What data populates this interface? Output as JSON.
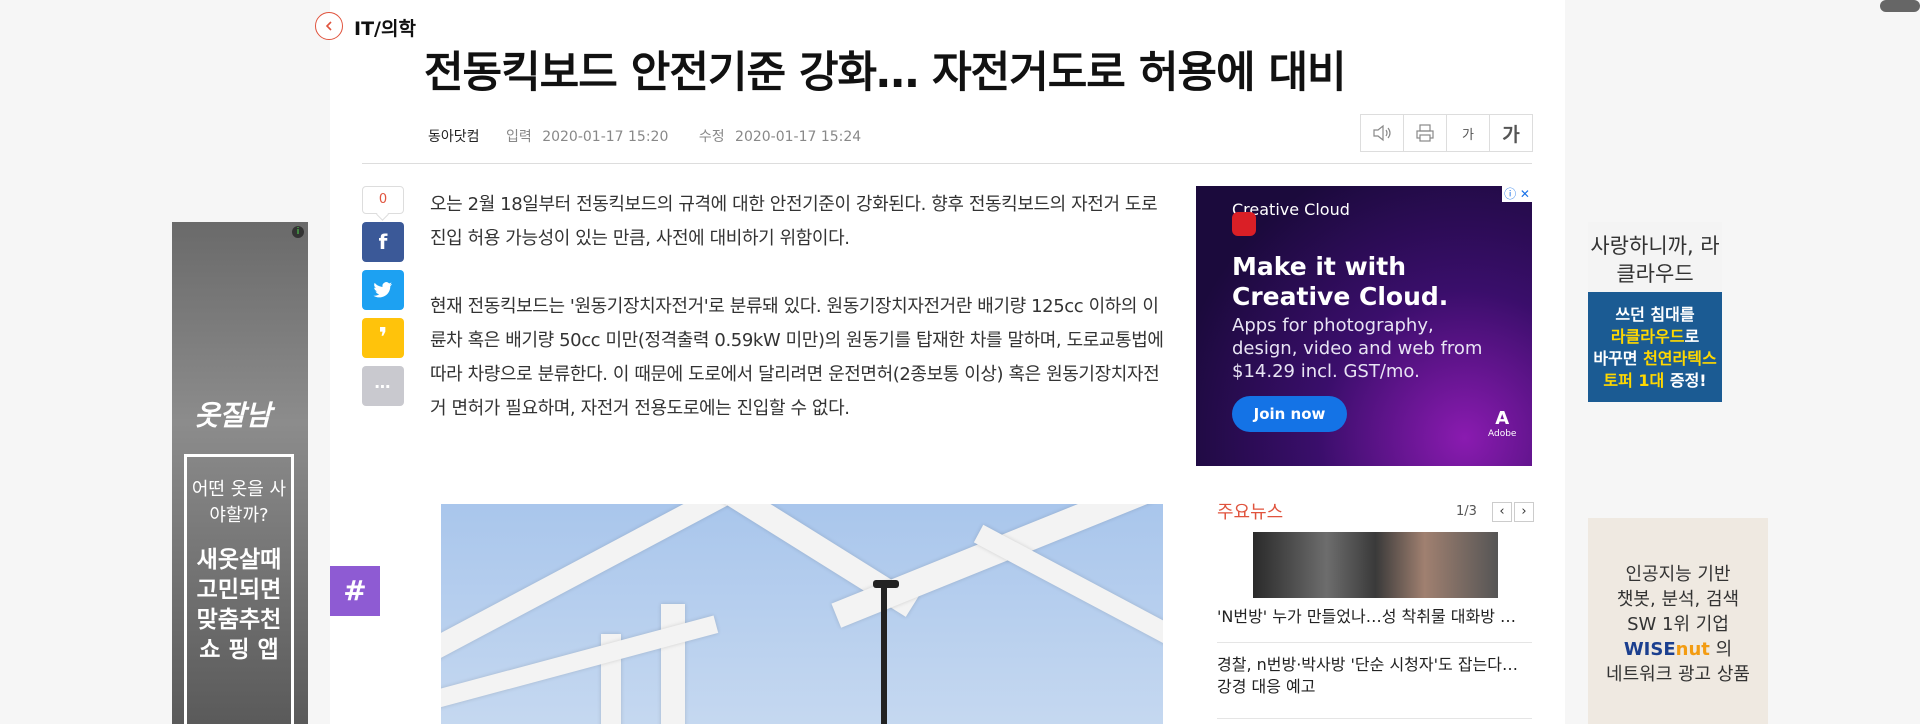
{
  "section": {
    "name": "IT/의학"
  },
  "article": {
    "headline": "전동킥보드 안전기준 강화… 자전거도로 허용에 대비",
    "source": "동아닷컴",
    "input_label": "입력",
    "input_time": "2020-01-17 15:20",
    "modified_label": "수정",
    "modified_time": "2020-01-17 15:24",
    "paragraphs": [
      "오는 2월 18일부터 전동킥보드의 규격에 대한 안전기준이 강화된다. 향후 전동킥보드의 자전거 도로 진입 허용 가능성이 있는 만큼, 사전에 대비하기 위함이다.",
      "현재 전동킥보드는 '원동기장치자전거'로 분류돼 있다. 원동기장치자전거란 배기량 125cc 이하의 이륜차 혹은 배기량 50cc 미만(정격출력 0.59kW 미만)의 원동기를 탑재한 차를 말하며, 도로교통법에 따라 차량으로 분류한다. 이 때문에 도로에서 달리려면 운전면허(2종보통 이상) 혹은 원동기장치자전거 면허가 필요하며, 자전거 전용도로에는 진입할 수 없다."
    ]
  },
  "tools": {
    "font_small": "가",
    "font_large": "가"
  },
  "share": {
    "like_count": "0",
    "facebook": "f",
    "kakaostory": "❜",
    "more": "⋯"
  },
  "hashtag": {
    "label": "#"
  },
  "ad_cc": {
    "brand": "Creative Cloud",
    "headline": "Make it with Creative Cloud.",
    "sub": "Apps for photography, design, video and web from $14.29 incl. GST/mo.",
    "button": "Join now",
    "maker": "Adobe",
    "close": "ⓘ ✕"
  },
  "main_news": {
    "title": "주요뉴스",
    "page": "1/3",
    "prev": "‹",
    "next": "›",
    "items": [
      "'N번방' 누가 만들었나…성 착취물 대화방 …",
      "경찰, n번방·박사방 '단순 시청자'도 잡는다… 강경 대응 예고"
    ]
  },
  "left_ad": {
    "brand": "옷잘남",
    "question": "어떤 옷을 사야할까?",
    "tagline": "새옷살때 고민되면 맞춤추천 쇼 핑 앱",
    "info": "i"
  },
  "right_ad1": {
    "top": "사랑하니까, 라클라우드",
    "line1": "쓰던 침대를",
    "line2a": "라클라우드",
    "line2b": "로",
    "line3a": "바꾸면 ",
    "line3b": "천연라텍스",
    "line4a": "토퍼 1대",
    "line4b": " 증정!"
  },
  "right_ad2": {
    "line1": "인공지능 기반",
    "line2": "챗봇, 분석, 검색",
    "line3": "SW 1위 기업",
    "brand_a": "WISE",
    "brand_b": "nut",
    "brand_suffix": " 의",
    "line5": "네트워크 광고 상품"
  }
}
